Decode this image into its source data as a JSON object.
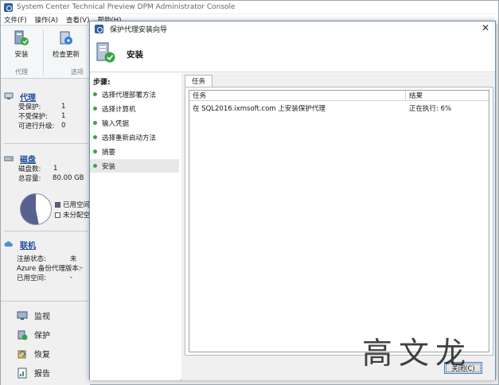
{
  "main_window": {
    "title": "System Center Technical Preview DPM Administrator Console",
    "menu": [
      "文件(F)",
      "操作(A)",
      "查看(V)",
      "帮助(H)"
    ]
  },
  "ribbon": {
    "install_label": "安装",
    "check_update_label": "检查更新",
    "group_agent": "代理",
    "group_options": "选项"
  },
  "nav": {
    "agents": {
      "title": "代理",
      "rows": [
        {
          "k": "受保护:",
          "v": "1"
        },
        {
          "k": "不受保护:",
          "v": "1"
        },
        {
          "k": "可进行升级:",
          "v": "0"
        }
      ]
    },
    "disks": {
      "title": "磁盘",
      "rows": [
        {
          "k": "磁盘数:",
          "v": "1"
        },
        {
          "k": "总容量:",
          "v": "80.00 GB"
        }
      ],
      "legend_used": "已用空间",
      "legend_unalloc": "未分配空间",
      "used_fraction": 0.53
    },
    "online": {
      "title": "联机",
      "rows": [
        {
          "k": "注册状态:",
          "v": "未"
        },
        {
          "k": "Azure 备份代理版本:",
          "v": "-"
        },
        {
          "k": "已用空间:",
          "v": "-"
        }
      ]
    },
    "workspaces": [
      {
        "label": "监视",
        "icon": "monitor-icon"
      },
      {
        "label": "保护",
        "icon": "protect-icon"
      },
      {
        "label": "恢复",
        "icon": "recover-icon"
      },
      {
        "label": "报告",
        "icon": "report-icon"
      }
    ]
  },
  "wizard": {
    "title": "保护代理安装向导",
    "header_title": "安装",
    "steps_heading": "步骤:",
    "steps": [
      "选择代理部署方法",
      "选择计算机",
      "输入凭据",
      "选择重新启动方法",
      "摘要",
      "安装"
    ],
    "tab": "任务",
    "columns": {
      "task": "任务",
      "result": "结果"
    },
    "rows": [
      {
        "task": "在 SQL2016.ixmsoft.com 上安装保护代理",
        "result": "正在执行: 6%"
      }
    ],
    "close_button": "关闭(C)"
  },
  "watermark": "高文龙",
  "colors": {
    "link_blue": "#1f4e9c",
    "step_green": "#36a83a",
    "pie_used": "#57618f",
    "dialog_border": "#6d8fb6"
  }
}
